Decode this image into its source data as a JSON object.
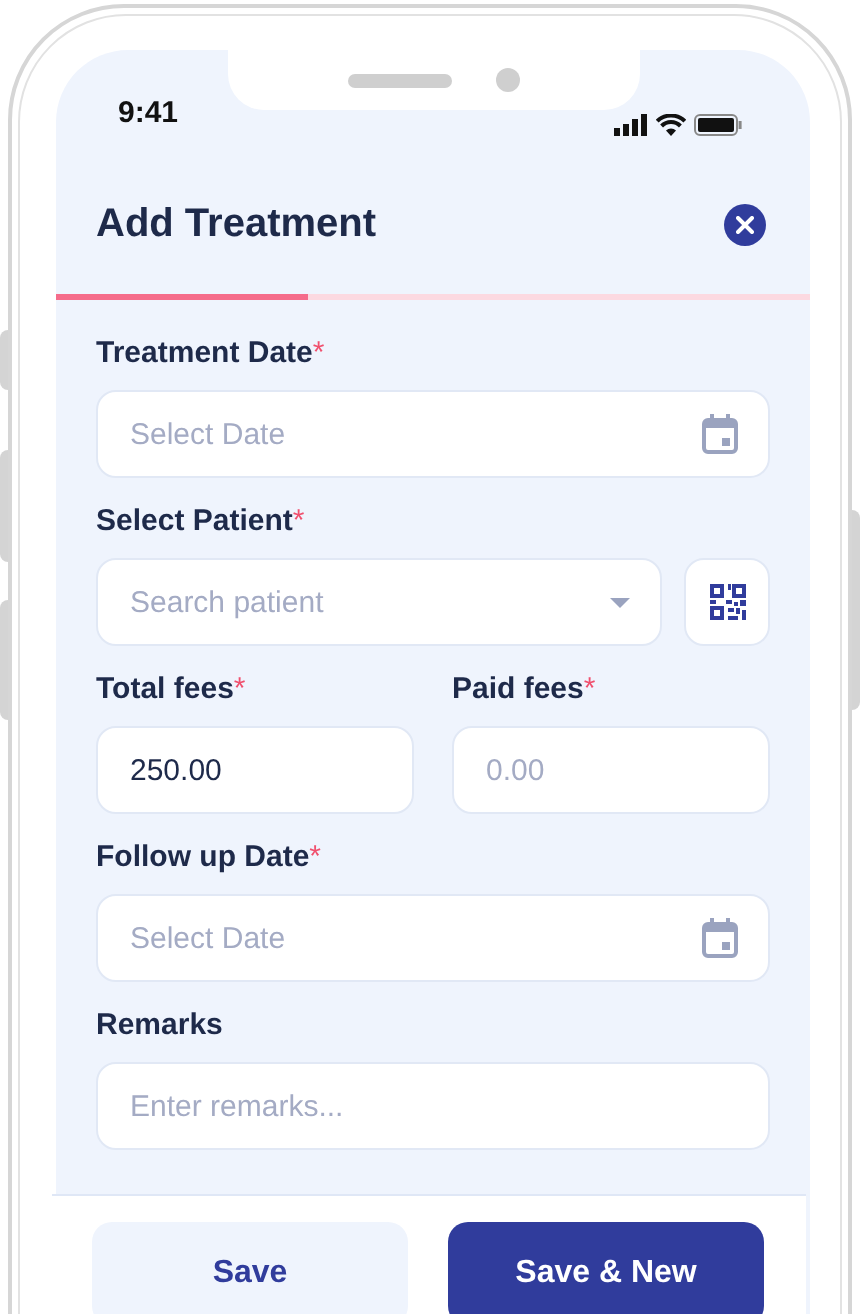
{
  "status_bar": {
    "time": "9:41"
  },
  "header": {
    "title": "Add Treatment"
  },
  "progress": {
    "level": 0.335
  },
  "fields": [
    {
      "kind": "date",
      "label": "Treatment Date",
      "mark": "*",
      "placeholder": "Select Date"
    },
    {
      "kind": "patient",
      "label": "Select Patient",
      "mark": "*",
      "placeholder": "Search patient"
    },
    {
      "kind": "pair",
      "items": [
        {
          "label": "Total fees",
          "mark": "*",
          "value": "250.00"
        },
        {
          "label": "Paid fees",
          "mark": "*",
          "placeholder": "0.00"
        }
      ]
    },
    {
      "kind": "date",
      "label": "Follow up Date",
      "mark": "*",
      "placeholder": "Select Date"
    },
    {
      "kind": "text",
      "label": "Remarks",
      "placeholder": "Enter remarks..."
    }
  ],
  "buttons": [
    {
      "label": "Save",
      "primary": false
    },
    {
      "label": "Save & New",
      "primary": true
    }
  ]
}
